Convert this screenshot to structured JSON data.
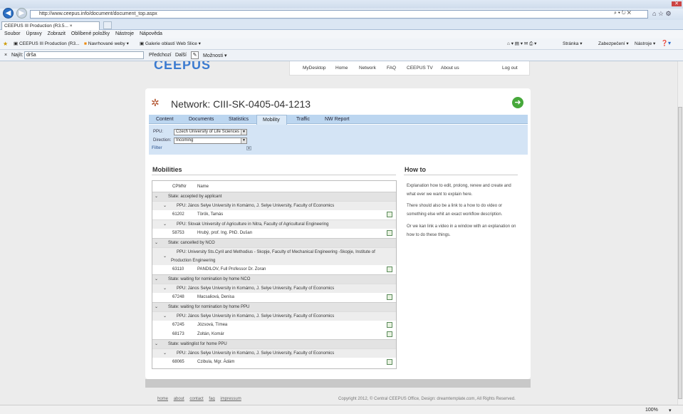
{
  "browser": {
    "url": "http://www.ceepus.info/document/document_top.aspx",
    "tab_title": "CEEPUS III Production (R3.5...",
    "tab_close": "×",
    "menu": [
      "Soubor",
      "Úpravy",
      "Zobrazit",
      "Oblíbené položky",
      "Nástroje",
      "Nápověda"
    ],
    "favorites": [
      "CEEPUS III Production (R3...",
      "Navrhované weby ▾",
      "Galerie oblastí Web Slice ▾"
    ],
    "commands": [
      "Stránka ▾",
      "Zabezpečení ▾",
      "Nástroje ▾"
    ],
    "find": {
      "close": "×",
      "label": "Najít:",
      "value": "drša",
      "prev": "Předchozí",
      "next": "Další",
      "options": "Možnosti ▾"
    },
    "zoom": "100%"
  },
  "site": {
    "logo": "CEEPUS",
    "nav": [
      "MyDesktop",
      "Home",
      "Network",
      "FAQ",
      "CEEPUS TV",
      "About us"
    ],
    "logout": "Log out"
  },
  "page": {
    "title": "Network: CIII-SK-0405-04-1213",
    "tabs": [
      "Content",
      "Documents",
      "Statistics",
      "Mobility",
      "Traffic",
      "NW Report"
    ],
    "filters": {
      "ppu_label": "PPU:",
      "ppu_value": "Czech University of Life Sciences",
      "direction_label": "Direction:",
      "direction_value": "Incoming",
      "filter_label": "Filter"
    },
    "mobilities_heading": "Mobilities",
    "howto_heading": "How to",
    "columns": [
      "CPMNr",
      "Name"
    ],
    "rows": [
      {
        "t": "s",
        "text": "State: accepted by applicant"
      },
      {
        "t": "p",
        "text": "PPU: János Selye University in Komárno, J. Selye University, Faculty of Economics"
      },
      {
        "t": "r",
        "nr": "61202",
        "name": "Török, Tamás"
      },
      {
        "t": "p",
        "text": "PPU: Slovak University of Agriculture in Nitra, Faculty of Agricultural Engineering"
      },
      {
        "t": "r",
        "nr": "58753",
        "name": "Hrubý, prof. Ing. PhD. Dušan"
      },
      {
        "t": "s",
        "text": "State: cancelled by NCO"
      },
      {
        "t": "p2",
        "text": "PPU: University Sts.Cyril and Methodius - Skopje, Faculty of Mechanical Engineering -Skopje, Institute of",
        "text2": "Production Engineering"
      },
      {
        "t": "r",
        "nr": "63110",
        "name": "PANDILOV, Full Professor Dr. Zoran"
      },
      {
        "t": "s",
        "text": "State: waiting for nomination by home NCO"
      },
      {
        "t": "p",
        "text": "PPU: János Selye University in Komárno, J. Selye University, Faculty of Economics"
      },
      {
        "t": "r",
        "nr": "67248",
        "name": "Macsaliová, Denisa"
      },
      {
        "t": "s",
        "text": "State: waiting for nomination by home PPU"
      },
      {
        "t": "p",
        "text": "PPU: János Selye University in Komárno, J. Selye University, Faculty of Economics"
      },
      {
        "t": "r",
        "nr": "67245",
        "name": "Józsová, Tímea"
      },
      {
        "t": "r",
        "nr": "68173",
        "name": "Zoltán, Komár"
      },
      {
        "t": "s",
        "text": "State: waitinglist for home PPU"
      },
      {
        "t": "p",
        "text": "PPU: János Selye University in Komárno, J. Selye University, Faculty of Economics"
      },
      {
        "t": "r",
        "nr": "68065",
        "name": "Czibula, Mgr. Ádám"
      }
    ],
    "howto": [
      "Explanation how to edit, prolong, renew and create and what ever we want to explain here.",
      "There should also be a link to a how to do video or something else whit an exact workflow description.",
      "Or we kan link a video in a window with an explanation on how to do these things."
    ]
  },
  "footer": {
    "links": [
      "home",
      "about",
      "contact",
      "faq",
      "impressum"
    ],
    "copyright": "Copyright 2012, © Central CEEPUS Office, Design: dreamtemplate.com, All Rights Reserved."
  }
}
